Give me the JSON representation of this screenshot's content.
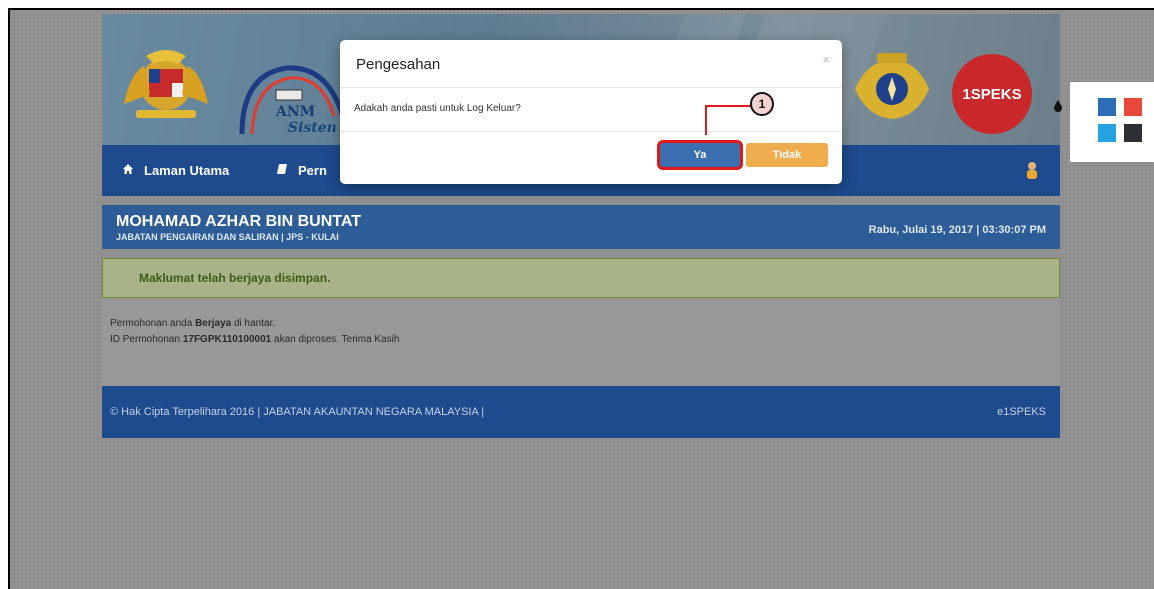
{
  "modal": {
    "title": "Pengesahan",
    "close": "×",
    "body": "Adakah anda pasti untuk Log Keluar?",
    "yes": "Ya",
    "no": "Tidak"
  },
  "callout": {
    "number": "1"
  },
  "banner": {
    "anm_text": "ANM",
    "anm_sub": "Sisten",
    "speks_logo": "1SPEKS"
  },
  "nav": {
    "home": "Laman Utama",
    "permohonan": "Pern"
  },
  "user": {
    "name": "MOHAMAD AZHAR BIN BUNTAT",
    "dept": "JABATAN PENGAIRAN DAN SALIRAN | JPS - KULAI",
    "datetime": "Rabu, Julai 19, 2017 | 03:30:07 PM"
  },
  "alert": {
    "text": "Maklumat telah berjaya disimpan."
  },
  "message": {
    "line1_pre": "Permohonan anda ",
    "line1_bold": "Berjaya",
    "line1_post": " di hantar.",
    "line2_pre": "ID Permohonan ",
    "line2_bold": "17FGPK110100001",
    "line2_post": " akan diproses. Terima Kasih"
  },
  "footer": {
    "left": "© Hak Cipta Terpelihara 2016 | JABATAN AKAUNTAN NEGARA MALAYSIA |",
    "right": "e1SPEKS"
  },
  "theme": {
    "colors": [
      "#2d6db5",
      "#e8483c",
      "#25a3e0",
      "#2c2f33"
    ]
  },
  "icons": {
    "home": "home-icon",
    "book": "book-icon",
    "user": "user-icon",
    "drop": "drop-icon"
  }
}
